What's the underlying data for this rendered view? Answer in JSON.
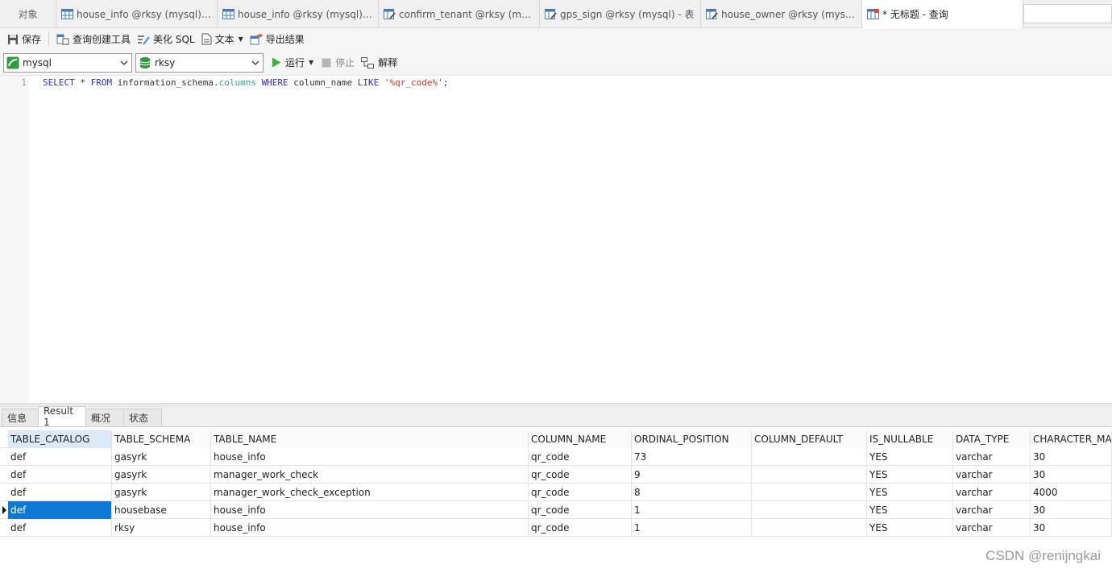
{
  "tabs": [
    {
      "label": "对象",
      "icon": "objects"
    },
    {
      "label": "house_info @rksy (mysql) - ...",
      "icon": "table-icon"
    },
    {
      "label": "house_info @rksy (mysql) - ...",
      "icon": "table-icon"
    },
    {
      "label": "confirm_tenant @rksy (mys...",
      "icon": "table-edit-icon"
    },
    {
      "label": "gps_sign @rksy (mysql) - 表",
      "icon": "table-edit-icon"
    },
    {
      "label": "house_owner @rksy (mysql)...",
      "icon": "table-edit-icon"
    },
    {
      "label": "* 无标题 - 查询",
      "icon": "query-icon"
    }
  ],
  "toolbar": {
    "save": "保存",
    "query_builder": "查询创建工具",
    "beautify_sql": "美化 SQL",
    "text": "文本",
    "export_results": "导出结果"
  },
  "selectors": {
    "connection": "mysql",
    "database": "rksy",
    "run": "运行",
    "stop": "停止",
    "explain": "解释"
  },
  "editor": {
    "line_number": "1",
    "sql_tokens": [
      {
        "t": "SELECT",
        "c": "kw"
      },
      {
        "t": " * ",
        "c": ""
      },
      {
        "t": "FROM",
        "c": "kw"
      },
      {
        "t": " information_schema.",
        "c": ""
      },
      {
        "t": "columns",
        "c": "obj"
      },
      {
        "t": " ",
        "c": ""
      },
      {
        "t": "WHERE",
        "c": "kw"
      },
      {
        "t": " column_name ",
        "c": ""
      },
      {
        "t": "LIKE",
        "c": "kw"
      },
      {
        "t": " ",
        "c": ""
      },
      {
        "t": "'%qr_code%'",
        "c": "str"
      },
      {
        "t": ";",
        "c": ""
      }
    ]
  },
  "result_tabs": [
    "信息",
    "Result 1",
    "概况",
    "状态"
  ],
  "result_active_tab": "Result 1",
  "grid": {
    "columns": [
      "TABLE_CATALOG",
      "TABLE_SCHEMA",
      "TABLE_NAME",
      "COLUMN_NAME",
      "ORDINAL_POSITION",
      "COLUMN_DEFAULT",
      "IS_NULLABLE",
      "DATA_TYPE",
      "CHARACTER_MA"
    ],
    "rows": [
      [
        "def",
        "gasyrk",
        "house_info",
        "qr_code",
        "73",
        "",
        "YES",
        "varchar",
        "30"
      ],
      [
        "def",
        "gasyrk",
        "manager_work_check",
        "qr_code",
        "9",
        "",
        "YES",
        "varchar",
        "30"
      ],
      [
        "def",
        "gasyrk",
        "manager_work_check_exception",
        "qr_code",
        "8",
        "",
        "YES",
        "varchar",
        "4000"
      ],
      [
        "def",
        "housebase",
        "house_info",
        "qr_code",
        "1",
        "",
        "YES",
        "varchar",
        "30"
      ],
      [
        "def",
        "rksy",
        "house_info",
        "qr_code",
        "1",
        "",
        "YES",
        "varchar",
        "30"
      ]
    ],
    "selected_row": 3,
    "selected_col": 0
  },
  "watermark": "CSDN @renijngkai",
  "colors": {
    "selection": "#0d78d6",
    "run": "#3cb43c",
    "keyword": "#2f2fd0",
    "string": "#c8332b"
  }
}
